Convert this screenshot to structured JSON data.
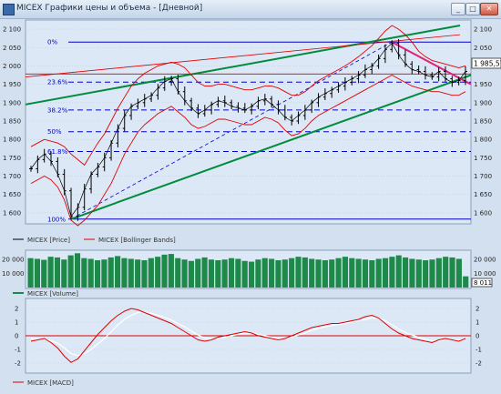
{
  "window": {
    "title": "MICEX Графики цены и объема - [Дневной]",
    "buttons": {
      "minimize": "_",
      "maximize": "□",
      "close": "✕"
    }
  },
  "colors": {
    "plot_bg": "#dce8f5",
    "price": "#000000",
    "bollinger": "#e00000",
    "volume": "#1e8a4a",
    "macd": "#e00000",
    "signal": "#ffffff",
    "fib": "#0000cc",
    "trend_green": "#008c3c",
    "trend_pink": "#e0207a"
  },
  "price_panel": {
    "last_value": "1 985,57",
    "y_ticks": [
      "2 100",
      "2 050",
      "2 000",
      "1 950",
      "1 900",
      "1 850",
      "1 800",
      "1 750",
      "1 700",
      "1 650",
      "1 600"
    ],
    "fib_levels": [
      {
        "label": "0%",
        "value": 2065
      },
      {
        "label": "23.6%",
        "value": 1956
      },
      {
        "label": "38.2%",
        "value": 1880
      },
      {
        "label": "50%",
        "value": 1821
      },
      {
        "label": "61.8%",
        "value": 1767
      },
      {
        "label": "100%",
        "value": 1583
      }
    ],
    "legend": [
      {
        "label": "MICEX [Price]"
      },
      {
        "label": "MICEX [Bollinger Bands]"
      }
    ]
  },
  "volume_panel": {
    "y_ticks": [
      "20 000",
      "10 000"
    ],
    "last_value": "8 011",
    "legend": [
      {
        "label": "MICEX [Volume]"
      }
    ]
  },
  "macd_panel": {
    "y_ticks": [
      "2",
      "1",
      "0",
      "-1",
      "-2"
    ],
    "legend": [
      {
        "label": "MICEX [MACD]"
      }
    ]
  },
  "chart_data": [
    {
      "type": "line",
      "title": "",
      "series": [
        {
          "name": "MICEX [Price]",
          "values": [
            1720,
            1745,
            1760,
            1740,
            1705,
            1660,
            1590,
            1615,
            1665,
            1705,
            1725,
            1750,
            1790,
            1830,
            1865,
            1890,
            1900,
            1910,
            1920,
            1940,
            1958,
            1965,
            1930,
            1905,
            1885,
            1870,
            1880,
            1895,
            1905,
            1900,
            1890,
            1885,
            1880,
            1890,
            1905,
            1910,
            1895,
            1880,
            1860,
            1850,
            1865,
            1880,
            1900,
            1915,
            1925,
            1935,
            1945,
            1955,
            1965,
            1975,
            1990,
            2000,
            2020,
            2045,
            2062,
            2030,
            2005,
            1990,
            1985,
            1975,
            1970,
            1985,
            1965,
            1955,
            1960,
            1985
          ]
        },
        {
          "name": "MICEX [Bollinger Bands] upper",
          "values": [
            1780,
            1790,
            1800,
            1795,
            1790,
            1780,
            1760,
            1745,
            1730,
            1760,
            1790,
            1815,
            1850,
            1885,
            1915,
            1945,
            1965,
            1980,
            1990,
            2000,
            2005,
            2010,
            2005,
            1995,
            1975,
            1955,
            1945,
            1945,
            1950,
            1950,
            1945,
            1940,
            1935,
            1935,
            1940,
            1945,
            1945,
            1940,
            1930,
            1920,
            1920,
            1930,
            1945,
            1960,
            1970,
            1980,
            1990,
            2000,
            2012,
            2025,
            2040,
            2055,
            2075,
            2095,
            2110,
            2100,
            2085,
            2065,
            2040,
            2025,
            2015,
            2010,
            2005,
            2000,
            1995,
            2000
          ]
        },
        {
          "name": "MICEX [Bollinger Bands] lower",
          "values": [
            1680,
            1690,
            1700,
            1690,
            1670,
            1635,
            1580,
            1565,
            1580,
            1600,
            1620,
            1650,
            1680,
            1720,
            1760,
            1790,
            1820,
            1840,
            1855,
            1870,
            1880,
            1890,
            1875,
            1860,
            1840,
            1830,
            1835,
            1845,
            1855,
            1855,
            1850,
            1845,
            1840,
            1840,
            1850,
            1860,
            1855,
            1845,
            1825,
            1810,
            1815,
            1830,
            1850,
            1865,
            1875,
            1885,
            1895,
            1905,
            1915,
            1925,
            1935,
            1945,
            1955,
            1965,
            1975,
            1965,
            1955,
            1945,
            1940,
            1935,
            1930,
            1930,
            1925,
            1920,
            1920,
            1930
          ]
        }
      ],
      "ylim": [
        1575,
        2120
      ]
    },
    {
      "type": "bar",
      "series": [
        {
          "name": "MICEX [Volume]",
          "values": [
            21000,
            20500,
            19800,
            22000,
            21500,
            20000,
            23000,
            24500,
            21000,
            20500,
            19500,
            20000,
            21500,
            22500,
            21000,
            20500,
            20000,
            19500,
            21000,
            22000,
            23500,
            24000,
            21000,
            20000,
            19000,
            20500,
            21500,
            20000,
            19500,
            20000,
            21000,
            20500,
            19000,
            18500,
            20000,
            21000,
            20500,
            19500,
            20000,
            21000,
            22000,
            21500,
            20500,
            20000,
            19500,
            20000,
            21000,
            22000,
            21000,
            20500,
            20000,
            19500,
            20500,
            21000,
            22000,
            23000,
            21500,
            20500,
            20000,
            19500,
            20000,
            21000,
            22000,
            21500,
            20500,
            8011
          ]
        }
      ],
      "ylim": [
        0,
        26000
      ]
    },
    {
      "type": "line",
      "series": [
        {
          "name": "MACD",
          "values": [
            -0.4,
            -0.3,
            -0.2,
            -0.5,
            -0.9,
            -1.5,
            -1.95,
            -1.7,
            -1.1,
            -0.5,
            0.1,
            0.6,
            1.1,
            1.5,
            1.8,
            2.0,
            1.9,
            1.7,
            1.5,
            1.3,
            1.1,
            0.9,
            0.6,
            0.3,
            0.0,
            -0.3,
            -0.4,
            -0.3,
            -0.1,
            0.0,
            0.1,
            0.2,
            0.3,
            0.2,
            0.0,
            -0.1,
            -0.2,
            -0.3,
            -0.2,
            0.0,
            0.2,
            0.4,
            0.6,
            0.7,
            0.8,
            0.9,
            0.9,
            1.0,
            1.1,
            1.2,
            1.4,
            1.5,
            1.3,
            0.9,
            0.5,
            0.2,
            0.0,
            -0.2,
            -0.3,
            -0.4,
            -0.5,
            -0.3,
            -0.2,
            -0.3,
            -0.4,
            -0.2
          ]
        },
        {
          "name": "Signal",
          "values": [
            -0.2,
            -0.25,
            -0.25,
            -0.35,
            -0.55,
            -0.9,
            -1.3,
            -1.45,
            -1.3,
            -1.0,
            -0.6,
            -0.2,
            0.3,
            0.8,
            1.2,
            1.5,
            1.7,
            1.75,
            1.65,
            1.5,
            1.35,
            1.15,
            0.9,
            0.65,
            0.35,
            0.05,
            -0.15,
            -0.25,
            -0.2,
            -0.1,
            0.0,
            0.1,
            0.2,
            0.2,
            0.1,
            0.0,
            -0.1,
            -0.2,
            -0.2,
            -0.1,
            0.05,
            0.2,
            0.4,
            0.55,
            0.65,
            0.75,
            0.85,
            0.9,
            1.0,
            1.1,
            1.2,
            1.3,
            1.3,
            1.1,
            0.8,
            0.5,
            0.25,
            0.05,
            -0.1,
            -0.25,
            -0.35,
            -0.35,
            -0.3,
            -0.3,
            -0.3,
            -0.25
          ]
        }
      ],
      "ylim": [
        -2.6,
        2.6
      ]
    }
  ]
}
